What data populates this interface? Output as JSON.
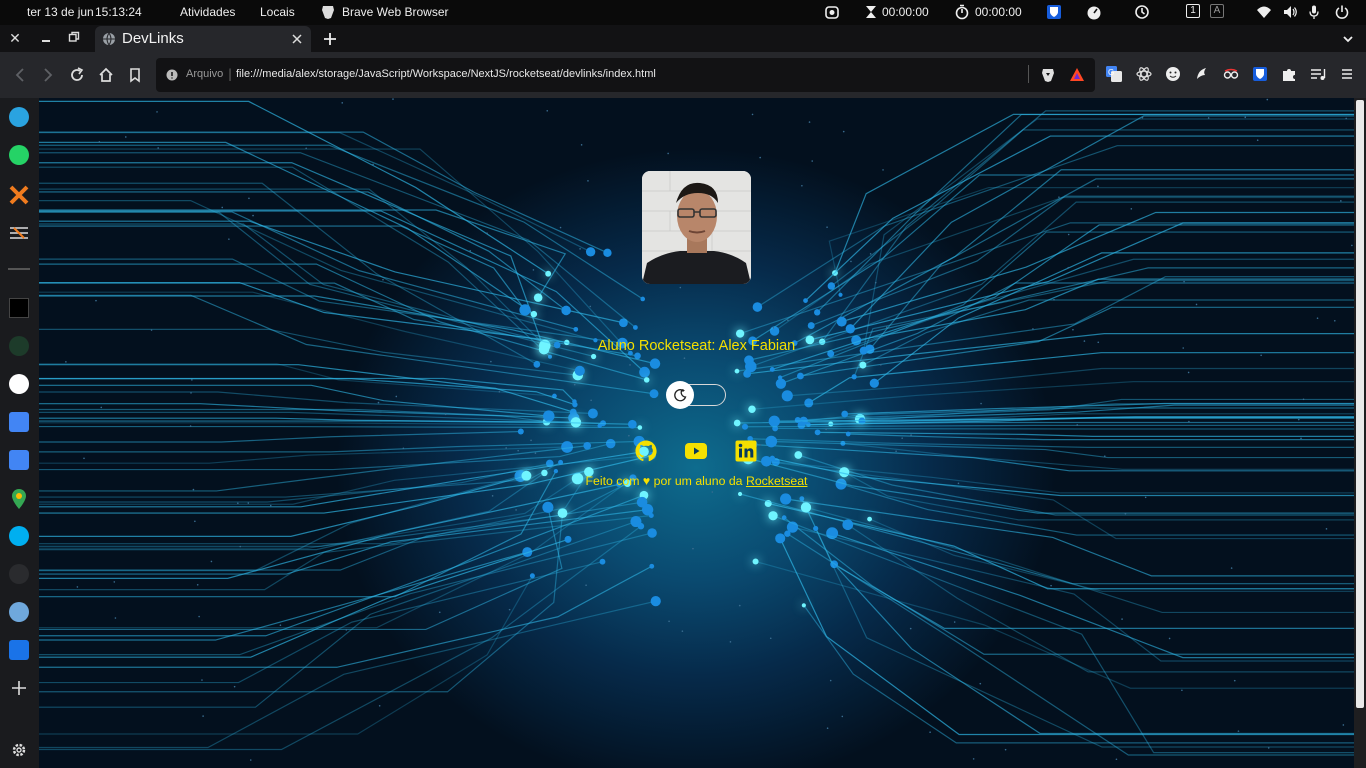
{
  "topbar": {
    "date": "ter 13 de jun",
    "time": "15:13:24",
    "activities": "Atividades",
    "places": "Locais",
    "app_name": "Brave Web Browser",
    "timer1": "00:00:00",
    "timer2": "00:00:00",
    "workspace": "1",
    "keyboard": "A"
  },
  "browser": {
    "tab_title": "DevLinks",
    "url_scheme_label": "Arquivo",
    "url": "file:///media/alex/storage/JavaScript/Workspace/NextJS/rocketseat/devlinks/index.html"
  },
  "page": {
    "name": "Aluno Rocketseat: Alex Fabian",
    "footer_prefix": "Feito com ♥ por um aluno da ",
    "footer_link": "Rocketseat"
  },
  "colors": {
    "accent_yellow": "#f5e000",
    "bg_center": "#0e6c8e",
    "bg_edge": "#03101e",
    "circuit": "#2fb8e8"
  },
  "icons": [
    "telegram-icon",
    "whatsapp-icon",
    "x-icon",
    "layers-icon",
    "tool-icon",
    "gamepad-icon",
    "google-icon",
    "calendar-icon",
    "translate-icon",
    "maps-icon",
    "skype-icon",
    "settings-gear-icon",
    "g-icon",
    "add-icon"
  ]
}
